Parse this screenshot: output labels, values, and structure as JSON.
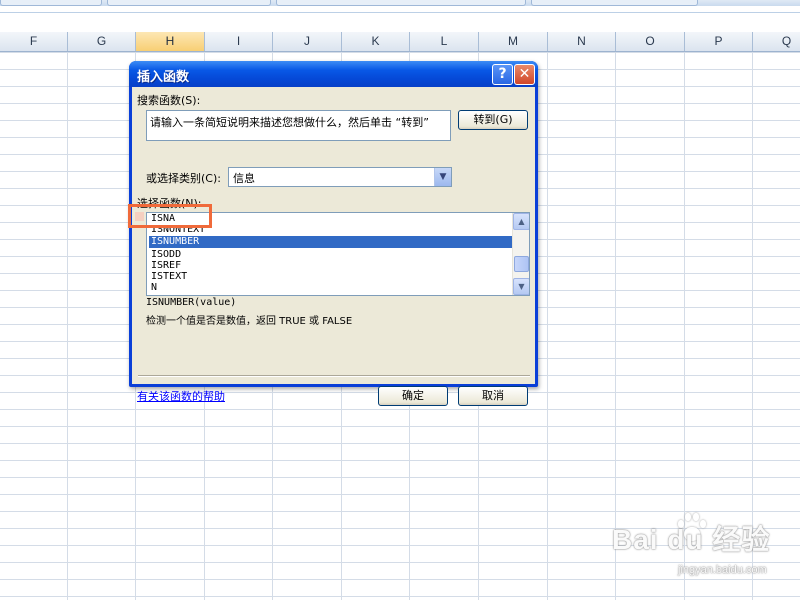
{
  "spreadsheet": {
    "columns": [
      "F",
      "G",
      "H",
      "I",
      "J",
      "K",
      "L",
      "M",
      "N",
      "O",
      "P",
      "Q"
    ],
    "active_column": "H"
  },
  "dialog": {
    "title": "插入函数",
    "help_button": "?",
    "close_button": "✕",
    "search_label": "搜索函数(S):",
    "search_value": "请输入一条简短说明来描述您想做什么，然后单击 “转到”",
    "go_button": "转到(G)",
    "category_label": "或选择类别(C):",
    "category_value": "信息",
    "function_list_label": "选择函数(N):",
    "functions": [
      "ISNA",
      "ISNONTEXT",
      "ISNUMBER",
      "ISODD",
      "ISREF",
      "ISTEXT",
      "N"
    ],
    "selected_function": "ISNUMBER",
    "syntax": "ISNUMBER(value)",
    "description": "检测一个值是否是数值，返回 TRUE 或 FALSE",
    "help_link": "有关该函数的帮助",
    "ok_button": "确定",
    "cancel_button": "取消"
  },
  "watermark": {
    "brand": "Bai du 经验",
    "url": "jingyan.baidu.com"
  },
  "colors": {
    "title_bar": "#0548d6",
    "dialog_bg": "#ece9d8",
    "selection": "#316ac5",
    "highlight": "#f06a3a",
    "link": "#0000ff"
  }
}
